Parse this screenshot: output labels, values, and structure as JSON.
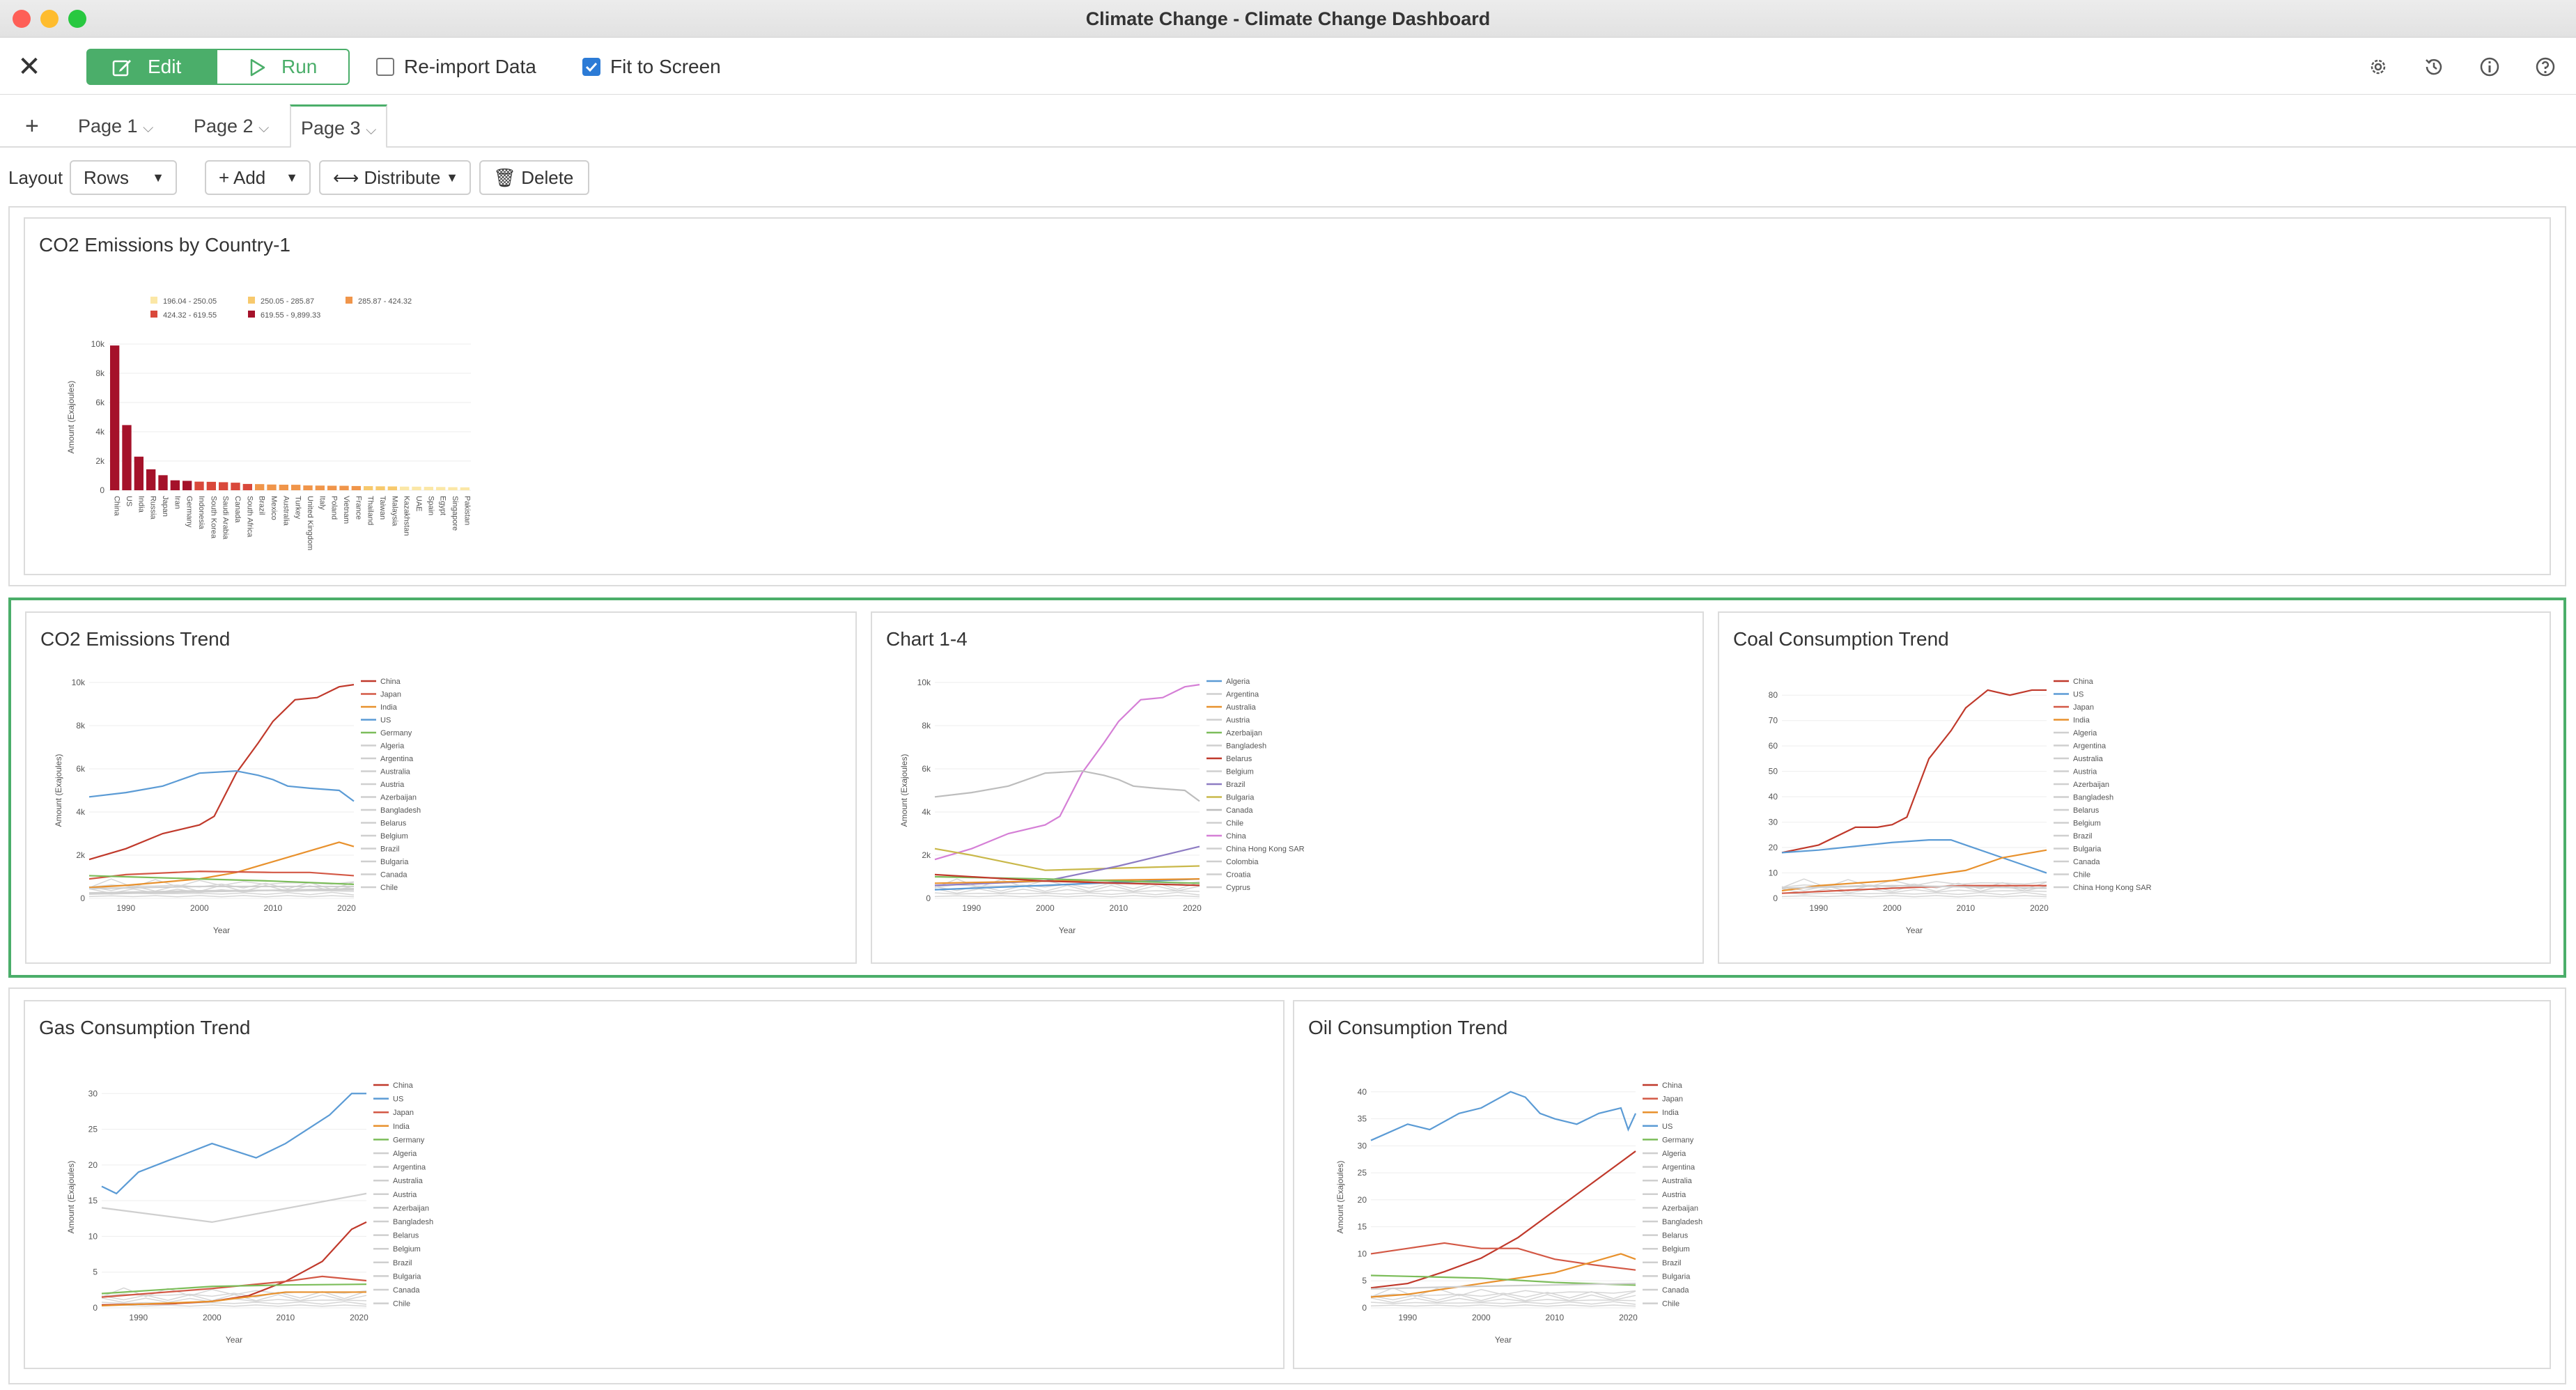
{
  "window": {
    "title": "Climate Change - Climate Change Dashboard",
    "traffic_colors": [
      "#fe5f57",
      "#febc2e",
      "#28c840"
    ]
  },
  "toolbar": {
    "close_glyph": "✕",
    "edit_label": "Edit",
    "run_label": "Run",
    "reimport_label": "Re-import Data",
    "reimport_checked": false,
    "fit_label": "Fit to Screen",
    "fit_checked": true,
    "icons": [
      "gear-icon",
      "history-icon",
      "info-icon",
      "help-icon"
    ]
  },
  "tabs": {
    "add_glyph": "+",
    "items": [
      {
        "label": "Page 1",
        "active": false
      },
      {
        "label": "Page 2",
        "active": false
      },
      {
        "label": "Page 3",
        "active": true
      }
    ]
  },
  "layoutbar": {
    "layout_label": "Layout",
    "rows_label": "Rows",
    "add_label": "Add",
    "distribute_label": "Distribute",
    "delete_label": "Delete"
  },
  "colors": {
    "accent": "#4bae6a",
    "china": "#c0392b",
    "us": "#5b9bd5",
    "japan": "#d35845",
    "india": "#e8912d",
    "germany": "#7cbd5a",
    "other": "#cfcfcf"
  },
  "chart_data": [
    {
      "title": "CO2 Emissions by Country-1",
      "type": "bar",
      "ylabel": "Amount (Exajoules)",
      "ylim": [
        0,
        10000
      ],
      "yticks": [
        "0",
        "2k",
        "4k",
        "6k",
        "8k",
        "10k"
      ],
      "legend": [
        "196.04 - 250.05",
        "250.05 - 285.87",
        "285.87 - 424.32",
        "424.32 - 619.55",
        "619.55 - 9,899.33"
      ],
      "legend_colors": [
        "#fbe7a6",
        "#f7c96d",
        "#f0954a",
        "#d9483b",
        "#a5122a"
      ],
      "categories": [
        "China",
        "US",
        "India",
        "Russia",
        "Japan",
        "Iran",
        "Germany",
        "Indonesia",
        "South Korea",
        "Saudi Arabia",
        "Canada",
        "South Africa",
        "Brazil",
        "Mexico",
        "Australia",
        "Turkey",
        "United Kingdom",
        "Italy",
        "Poland",
        "Vietnam",
        "France",
        "Thailand",
        "Taiwan",
        "Malaysia",
        "Kazakhstan",
        "UAE",
        "Spain",
        "Egypt",
        "Singapore",
        "Pakistan"
      ],
      "values": [
        9899,
        4457,
        2298,
        1432,
        1030,
        680,
        644,
        590,
        577,
        550,
        518,
        432,
        420,
        392,
        380,
        376,
        330,
        320,
        310,
        306,
        290,
        282,
        270,
        262,
        250,
        246,
        236,
        222,
        210,
        200
      ]
    },
    {
      "title": "CO2 Emissions Trend",
      "type": "line",
      "xlabel": "Year",
      "ylabel": "Amount (Exajoules)",
      "x_ticks": [
        "1990",
        "2000",
        "2010",
        "2020"
      ],
      "xlim": [
        1985,
        2021
      ],
      "ylim": [
        0,
        10000
      ],
      "yticks": [
        "0",
        "2k",
        "4k",
        "6k",
        "8k",
        "10k"
      ],
      "legend": [
        "China",
        "Japan",
        "India",
        "US",
        "Germany",
        "Algeria",
        "Argentina",
        "Australia",
        "Austria",
        "Azerbaijan",
        "Bangladesh",
        "Belarus",
        "Belgium",
        "Brazil",
        "Bulgaria",
        "Canada",
        "Chile"
      ],
      "series": [
        {
          "name": "China",
          "color": "#c0392b",
          "x": [
            1985,
            1990,
            1995,
            2000,
            2002,
            2005,
            2008,
            2010,
            2013,
            2016,
            2019,
            2021
          ],
          "y": [
            1800,
            2300,
            3000,
            3400,
            3800,
            5800,
            7200,
            8200,
            9200,
            9300,
            9800,
            9900
          ]
        },
        {
          "name": "US",
          "color": "#5b9bd5",
          "x": [
            1985,
            1990,
            1995,
            2000,
            2005,
            2008,
            2010,
            2012,
            2015,
            2019,
            2021
          ],
          "y": [
            4700,
            4900,
            5200,
            5800,
            5900,
            5700,
            5500,
            5200,
            5100,
            5000,
            4500
          ]
        },
        {
          "name": "India",
          "color": "#e8912d",
          "x": [
            1985,
            1990,
            2000,
            2005,
            2010,
            2015,
            2019,
            2021
          ],
          "y": [
            500,
            600,
            900,
            1200,
            1700,
            2200,
            2600,
            2400
          ]
        },
        {
          "name": "Japan",
          "color": "#d35845",
          "x": [
            1985,
            1990,
            2000,
            2010,
            2015,
            2021
          ],
          "y": [
            900,
            1100,
            1250,
            1200,
            1200,
            1050
          ]
        },
        {
          "name": "Germany",
          "color": "#7cbd5a",
          "x": [
            1985,
            1990,
            2000,
            2010,
            2021
          ],
          "y": [
            1050,
            1000,
            900,
            800,
            650
          ]
        },
        {
          "name": "Canada",
          "color": "#cfcfcf",
          "x": [
            1985,
            2000,
            2021
          ],
          "y": [
            450,
            550,
            550
          ]
        },
        {
          "name": "Australia",
          "color": "#cfcfcf",
          "x": [
            1985,
            2000,
            2021
          ],
          "y": [
            250,
            350,
            400
          ]
        },
        {
          "name": "Brazil",
          "color": "#cfcfcf",
          "x": [
            1985,
            2000,
            2021
          ],
          "y": [
            200,
            300,
            450
          ]
        }
      ]
    },
    {
      "title": "Chart 1-4",
      "type": "line",
      "xlabel": "Year",
      "ylabel": "Amount (Exajoules)",
      "x_ticks": [
        "1990",
        "2000",
        "2010",
        "2020"
      ],
      "xlim": [
        1985,
        2021
      ],
      "ylim": [
        0,
        10000
      ],
      "yticks": [
        "0",
        "2k",
        "4k",
        "6k",
        "8k",
        "10k"
      ],
      "legend": [
        "Algeria",
        "Argentina",
        "Australia",
        "Austria",
        "Azerbaijan",
        "Bangladesh",
        "Belarus",
        "Belgium",
        "Brazil",
        "Bulgaria",
        "Canada",
        "Chile",
        "China",
        "China Hong Kong SAR",
        "Colombia",
        "Croatia",
        "Cyprus"
      ],
      "series": [
        {
          "name": "China",
          "color": "#d57fd6",
          "x": [
            1985,
            1990,
            1995,
            2000,
            2002,
            2005,
            2008,
            2010,
            2013,
            2016,
            2019,
            2021
          ],
          "y": [
            1800,
            2300,
            3000,
            3400,
            3800,
            5800,
            7200,
            8200,
            9200,
            9300,
            9800,
            9900
          ]
        },
        {
          "name": "Canada",
          "color": "#bdbdbd",
          "x": [
            1985,
            1990,
            1995,
            2000,
            2005,
            2008,
            2010,
            2012,
            2015,
            2019,
            2021
          ],
          "y": [
            4700,
            4900,
            5200,
            5800,
            5900,
            5700,
            5500,
            5200,
            5100,
            5000,
            4500
          ]
        },
        {
          "name": "Bulgaria",
          "color": "#c9b84a",
          "x": [
            1985,
            1990,
            2000,
            2010,
            2021
          ],
          "y": [
            2300,
            2000,
            1300,
            1400,
            1500
          ]
        },
        {
          "name": "Brazil",
          "color": "#8e7cc3",
          "x": [
            1985,
            2000,
            2010,
            2021
          ],
          "y": [
            600,
            800,
            1500,
            2400
          ]
        },
        {
          "name": "Algeria",
          "color": "#5b9bd5",
          "x": [
            1985,
            2000,
            2021
          ],
          "y": [
            400,
            600,
            900
          ]
        },
        {
          "name": "Australia",
          "color": "#e8912d",
          "x": [
            1985,
            2000,
            2021
          ],
          "y": [
            700,
            800,
            900
          ]
        },
        {
          "name": "Azerbaijan",
          "color": "#7cbd5a",
          "x": [
            1985,
            2000,
            2021
          ],
          "y": [
            1000,
            900,
            700
          ]
        },
        {
          "name": "Belarus",
          "color": "#c0392b",
          "x": [
            1985,
            2000,
            2021
          ],
          "y": [
            1100,
            800,
            600
          ]
        }
      ]
    },
    {
      "title": "Coal Consumption Trend",
      "type": "line",
      "xlabel": "Year",
      "x_ticks": [
        "1990",
        "2000",
        "2010",
        "2020"
      ],
      "xlim": [
        1985,
        2021
      ],
      "ylim": [
        0,
        85
      ],
      "yticks": [
        "0",
        "10",
        "20",
        "30",
        "40",
        "50",
        "60",
        "70",
        "80"
      ],
      "legend": [
        "China",
        "US",
        "Japan",
        "India",
        "Algeria",
        "Argentina",
        "Australia",
        "Austria",
        "Azerbaijan",
        "Bangladesh",
        "Belarus",
        "Belgium",
        "Brazil",
        "Bulgaria",
        "Canada",
        "Chile",
        "China Hong Kong SAR"
      ],
      "series": [
        {
          "name": "China",
          "color": "#c0392b",
          "x": [
            1985,
            1990,
            1995,
            1998,
            2000,
            2002,
            2005,
            2008,
            2010,
            2013,
            2016,
            2019,
            2021
          ],
          "y": [
            18,
            21,
            28,
            28,
            29,
            32,
            55,
            66,
            75,
            82,
            80,
            82,
            82
          ]
        },
        {
          "name": "US",
          "color": "#5b9bd5",
          "x": [
            1985,
            1990,
            2000,
            2005,
            2008,
            2010,
            2015,
            2019,
            2021
          ],
          "y": [
            18,
            19,
            22,
            23,
            23,
            21,
            16,
            12,
            10
          ]
        },
        {
          "name": "India",
          "color": "#e8912d",
          "x": [
            1985,
            1990,
            2000,
            2010,
            2015,
            2019,
            2021
          ],
          "y": [
            3,
            5,
            7,
            11,
            16,
            18,
            19
          ]
        },
        {
          "name": "Japan",
          "color": "#d35845",
          "x": [
            1985,
            2000,
            2010,
            2021
          ],
          "y": [
            2,
            4,
            5,
            5
          ]
        },
        {
          "name": "Australia",
          "color": "#cfcfcf",
          "x": [
            1985,
            2000,
            2021
          ],
          "y": [
            4,
            5,
            4
          ]
        }
      ]
    },
    {
      "title": "Gas Consumption Trend",
      "type": "line",
      "xlabel": "Year",
      "ylabel": "Amount (Exajoules)",
      "x_ticks": [
        "1990",
        "2000",
        "2010",
        "2020"
      ],
      "xlim": [
        1985,
        2021
      ],
      "ylim": [
        0,
        31
      ],
      "yticks": [
        "0",
        "5",
        "10",
        "15",
        "20",
        "25",
        "30"
      ],
      "legend": [
        "China",
        "US",
        "Japan",
        "India",
        "Germany",
        "Algeria",
        "Argentina",
        "Australia",
        "Austria",
        "Azerbaijan",
        "Bangladesh",
        "Belarus",
        "Belgium",
        "Brazil",
        "Bulgaria",
        "Canada",
        "Chile"
      ],
      "series": [
        {
          "name": "US",
          "color": "#5b9bd5",
          "x": [
            1985,
            1987,
            1990,
            1995,
            2000,
            2003,
            2006,
            2010,
            2013,
            2016,
            2019,
            2021
          ],
          "y": [
            17,
            16,
            19,
            21,
            23,
            22,
            21,
            23,
            25,
            27,
            30,
            30
          ]
        },
        {
          "name": "China",
          "color": "#c0392b",
          "x": [
            1985,
            1995,
            2000,
            2005,
            2010,
            2015,
            2019,
            2021
          ],
          "y": [
            0.4,
            0.6,
            0.9,
            1.7,
            3.7,
            6.5,
            11,
            12
          ]
        },
        {
          "name": "Japan",
          "color": "#d35845",
          "x": [
            1985,
            2000,
            2010,
            2015,
            2021
          ],
          "y": [
            1.5,
            2.7,
            3.7,
            4.4,
            3.8
          ]
        },
        {
          "name": "Germany",
          "color": "#7cbd5a",
          "x": [
            1985,
            2000,
            2010,
            2021
          ],
          "y": [
            2,
            3,
            3.2,
            3.3
          ]
        },
        {
          "name": "India",
          "color": "#e8912d",
          "x": [
            1985,
            2000,
            2010,
            2021
          ],
          "y": [
            0.3,
            0.9,
            2.2,
            2.2
          ]
        },
        {
          "name": "Canada",
          "color": "#cfcfcf",
          "x": [
            1985,
            2000,
            2021
          ],
          "y": [
            14,
            12,
            16
          ]
        }
      ]
    },
    {
      "title": "Oil Consumption Trend",
      "type": "line",
      "xlabel": "Year",
      "ylabel": "Amount (Exajoules)",
      "x_ticks": [
        "1990",
        "2000",
        "2010",
        "2020"
      ],
      "xlim": [
        1985,
        2021
      ],
      "ylim": [
        0,
        41
      ],
      "yticks": [
        "0",
        "5",
        "10",
        "15",
        "20",
        "25",
        "30",
        "35",
        "40"
      ],
      "legend": [
        "China",
        "Japan",
        "India",
        "US",
        "Germany",
        "Algeria",
        "Argentina",
        "Australia",
        "Austria",
        "Azerbaijan",
        "Bangladesh",
        "Belarus",
        "Belgium",
        "Brazil",
        "Bulgaria",
        "Canada",
        "Chile"
      ],
      "series": [
        {
          "name": "US",
          "color": "#5b9bd5",
          "x": [
            1985,
            1990,
            1993,
            1997,
            2000,
            2004,
            2006,
            2008,
            2010,
            2013,
            2016,
            2019,
            2020,
            2021
          ],
          "y": [
            31,
            34,
            33,
            36,
            37,
            40,
            39,
            36,
            35,
            34,
            36,
            37,
            33,
            36
          ]
        },
        {
          "name": "China",
          "color": "#c0392b",
          "x": [
            1985,
            1990,
            1995,
            2000,
            2005,
            2010,
            2015,
            2019,
            2021
          ],
          "y": [
            3.7,
            4.5,
            6.7,
            9.2,
            13,
            18,
            23,
            27,
            29
          ]
        },
        {
          "name": "Japan",
          "color": "#d35845",
          "x": [
            1985,
            1990,
            1995,
            2000,
            2005,
            2010,
            2015,
            2021
          ],
          "y": [
            10,
            11,
            12,
            11,
            11,
            9,
            8,
            7
          ]
        },
        {
          "name": "India",
          "color": "#e8912d",
          "x": [
            1985,
            1990,
            2000,
            2010,
            2019,
            2021
          ],
          "y": [
            2,
            2.5,
            4.5,
            6.5,
            10,
            9
          ]
        },
        {
          "name": "Germany",
          "color": "#7cbd5a",
          "x": [
            1985,
            2000,
            2010,
            2021
          ],
          "y": [
            6,
            5.5,
            4.7,
            4.2
          ]
        },
        {
          "name": "Canada",
          "color": "#cfcfcf",
          "x": [
            1985,
            2000,
            2021
          ],
          "y": [
            3.5,
            4,
            4.5
          ]
        }
      ]
    }
  ]
}
